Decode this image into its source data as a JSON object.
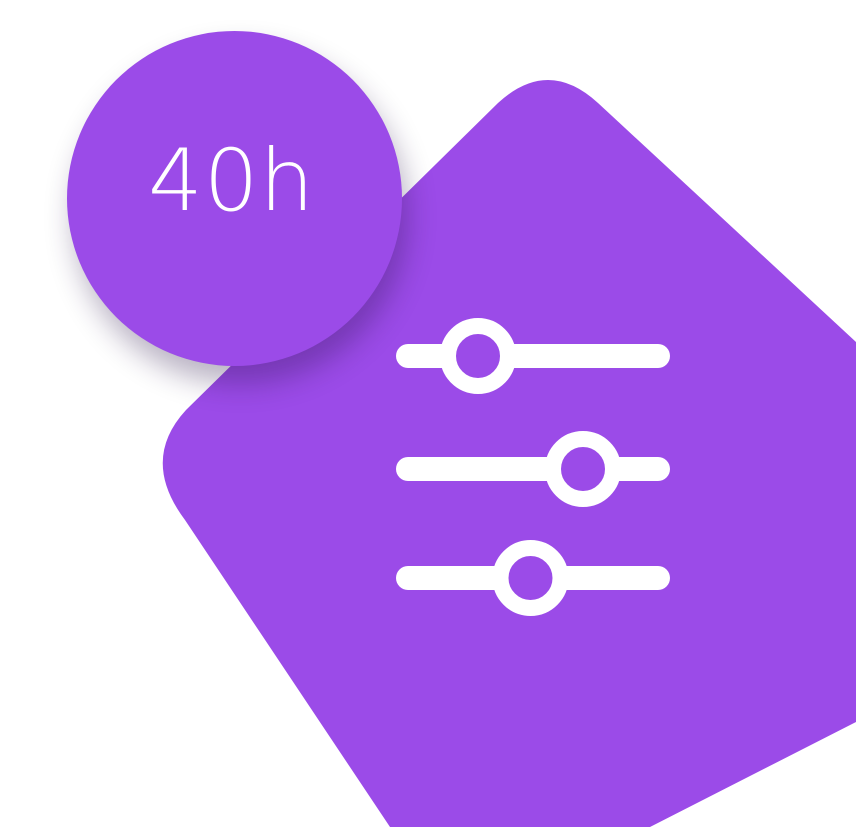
{
  "badge": {
    "label": "40h"
  },
  "colors": {
    "accent": "#9b4be8",
    "foreground": "#ffffff",
    "background": "#ffffff"
  },
  "icon": {
    "name": "sliders-icon",
    "sliders": [
      {
        "name": "slider-1",
        "level": 0.28
      },
      {
        "name": "slider-2",
        "level": 0.7
      },
      {
        "name": "slider-3",
        "level": 0.49
      }
    ]
  }
}
